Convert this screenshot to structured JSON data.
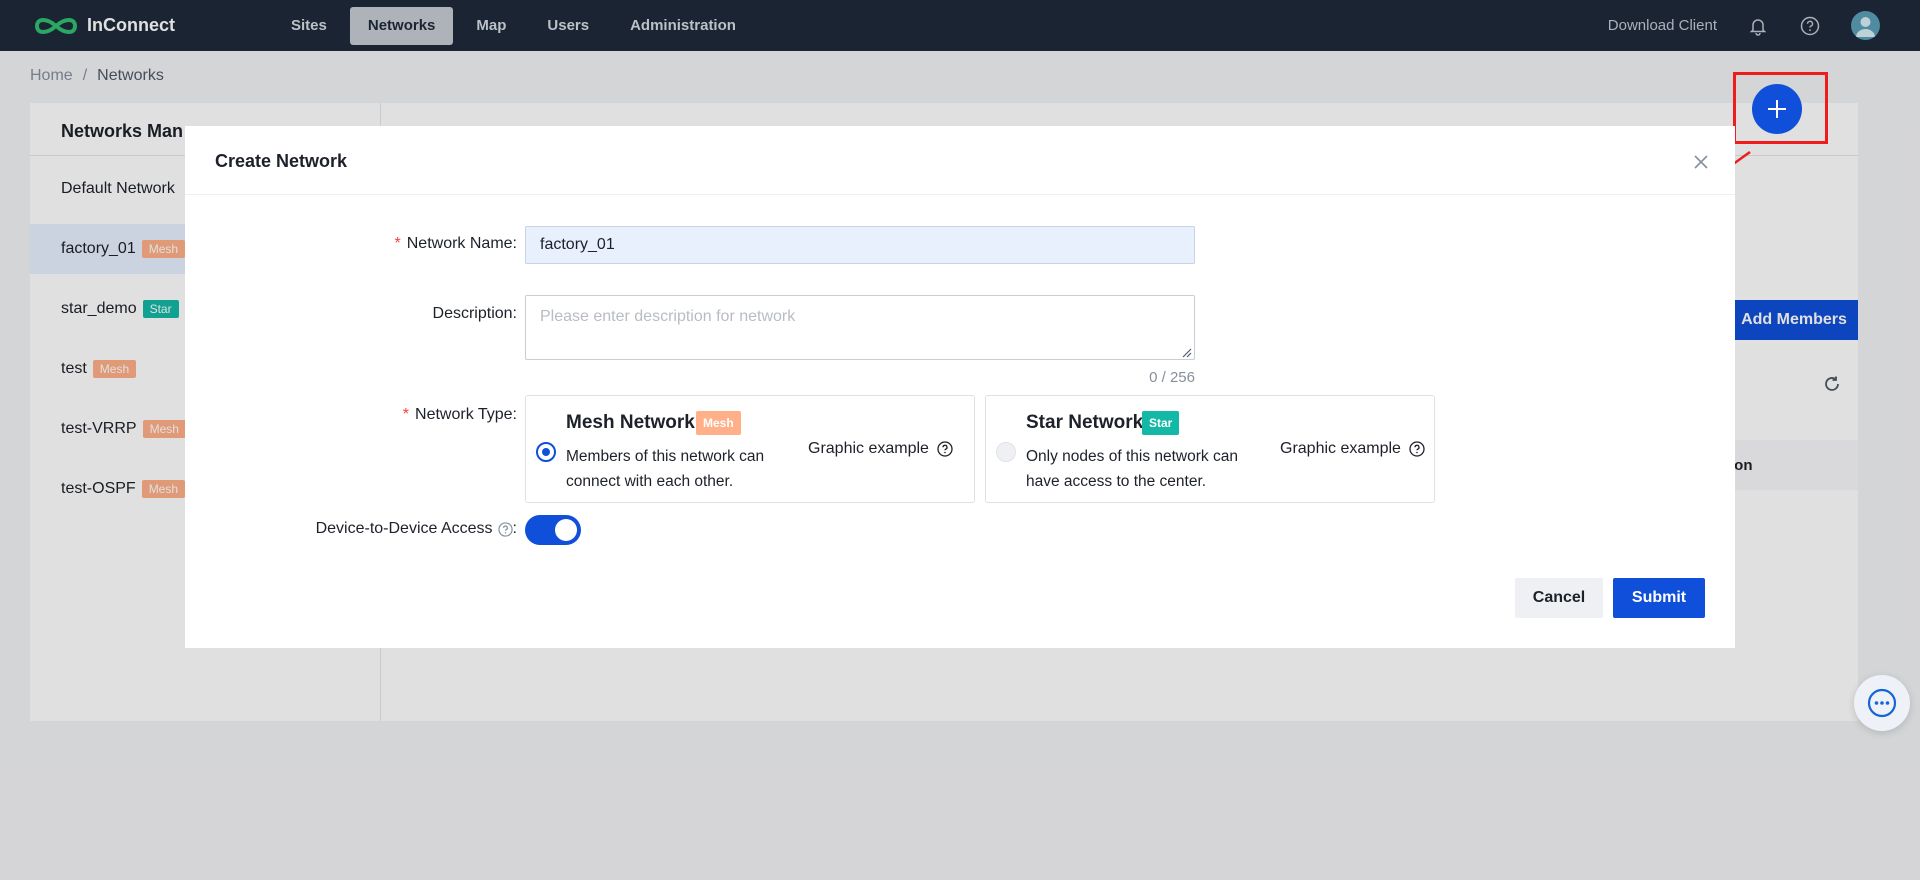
{
  "app": {
    "name": "InConnect"
  },
  "nav": {
    "items": [
      "Sites",
      "Networks",
      "Map",
      "Users",
      "Administration"
    ],
    "active": "Networks"
  },
  "topbar": {
    "download_label": "Download Client"
  },
  "breadcrumb": {
    "home": "Home",
    "separator": "/",
    "current": "Networks"
  },
  "panel": {
    "title": "Networks Man",
    "default_network": "Default Network",
    "networks": [
      {
        "name": "factory_01",
        "type_tag": "Mesh",
        "selected": true
      },
      {
        "name": "star_demo",
        "type_tag": "Star",
        "selected": false
      },
      {
        "name": "test",
        "type_tag": "Mesh",
        "selected": false
      },
      {
        "name": "test-VRRP",
        "type_tag": "Mesh",
        "selected": false
      },
      {
        "name": "test-OSPF",
        "type_tag": "Mesh",
        "selected": false
      }
    ],
    "add_members_label": "Add Members",
    "column_header_partial": "ion"
  },
  "modal": {
    "title": "Create Network",
    "network_name_label": "Network Name",
    "network_name_value": "factory_01",
    "description_label": "Description",
    "description_placeholder": "Please enter description for network",
    "description_counter": "0 / 256",
    "network_type_label": "Network Type",
    "types": [
      {
        "title": "Mesh Network",
        "tag": "Mesh",
        "description": "Members of this network can connect with each other.",
        "graphic_label": "Graphic example",
        "selected": true
      },
      {
        "title": "Star Network",
        "tag": "Star",
        "description": "Only nodes of this network can have access to the center.",
        "graphic_label": "Graphic example",
        "selected": false
      }
    ],
    "d2d_label": "Device-to-Device Access",
    "d2d_enabled": true,
    "cancel_label": "Cancel",
    "submit_label": "Submit"
  },
  "colors": {
    "primary": "#0f4fd9",
    "topbar": "#1e2a3a",
    "mesh_tag": "#ffb088",
    "star_tag": "#14b8a6",
    "annotation": "#ee1c1c"
  }
}
